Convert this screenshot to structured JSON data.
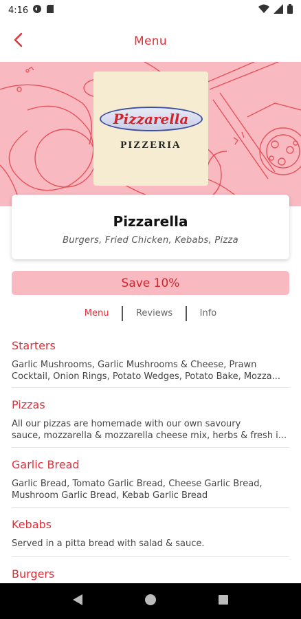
{
  "status_bar": {
    "time": "4:16"
  },
  "app_bar": {
    "title": "Menu"
  },
  "restaurant": {
    "logo_name": "Pizzarella",
    "logo_sub": "PIZZERIA",
    "name": "Pizzarella",
    "cuisines": "Burgers, Fried Chicken, Kebabs, Pizza"
  },
  "promo": {
    "label": "Save 10%"
  },
  "tabs": [
    {
      "label": "Menu",
      "active": true
    },
    {
      "label": "Reviews",
      "active": false
    },
    {
      "label": "Info",
      "active": false
    }
  ],
  "categories": [
    {
      "title": "Starters",
      "line1": "Garlic Mushrooms, Garlic Mushrooms & Cheese, Prawn",
      "line2": "Cocktail, Onion Rings, Potato Wedges, Potato Bake, Mozza..."
    },
    {
      "title": "Pizzas",
      "line1": "All our pizzas are homemade with our own savoury",
      "line2": "sauce, mozzarella & mozzarella cheese mix, herbs & fresh i..."
    },
    {
      "title": "Garlic Bread",
      "line1": "Garlic Bread, Tomato Garlic Bread, Cheese Garlic Bread,",
      "line2": "Mushroom Garlic Bread, Kebab Garlic Bread"
    },
    {
      "title": "Kebabs",
      "line1": "Served in a pitta bread with salad & sauce.",
      "line2": ""
    },
    {
      "title": "Burgers",
      "line1": "",
      "line2": ""
    }
  ],
  "colors": {
    "accent": "#e0303a",
    "hero_bg": "#f8b9c0",
    "logo_bg": "#f5ecd2",
    "nav_bg": "#000000"
  },
  "icons": {
    "back": "chevron-left-icon",
    "nav_back": "triangle-back-icon",
    "nav_home": "circle-home-icon",
    "nav_recents": "square-recents-icon"
  }
}
